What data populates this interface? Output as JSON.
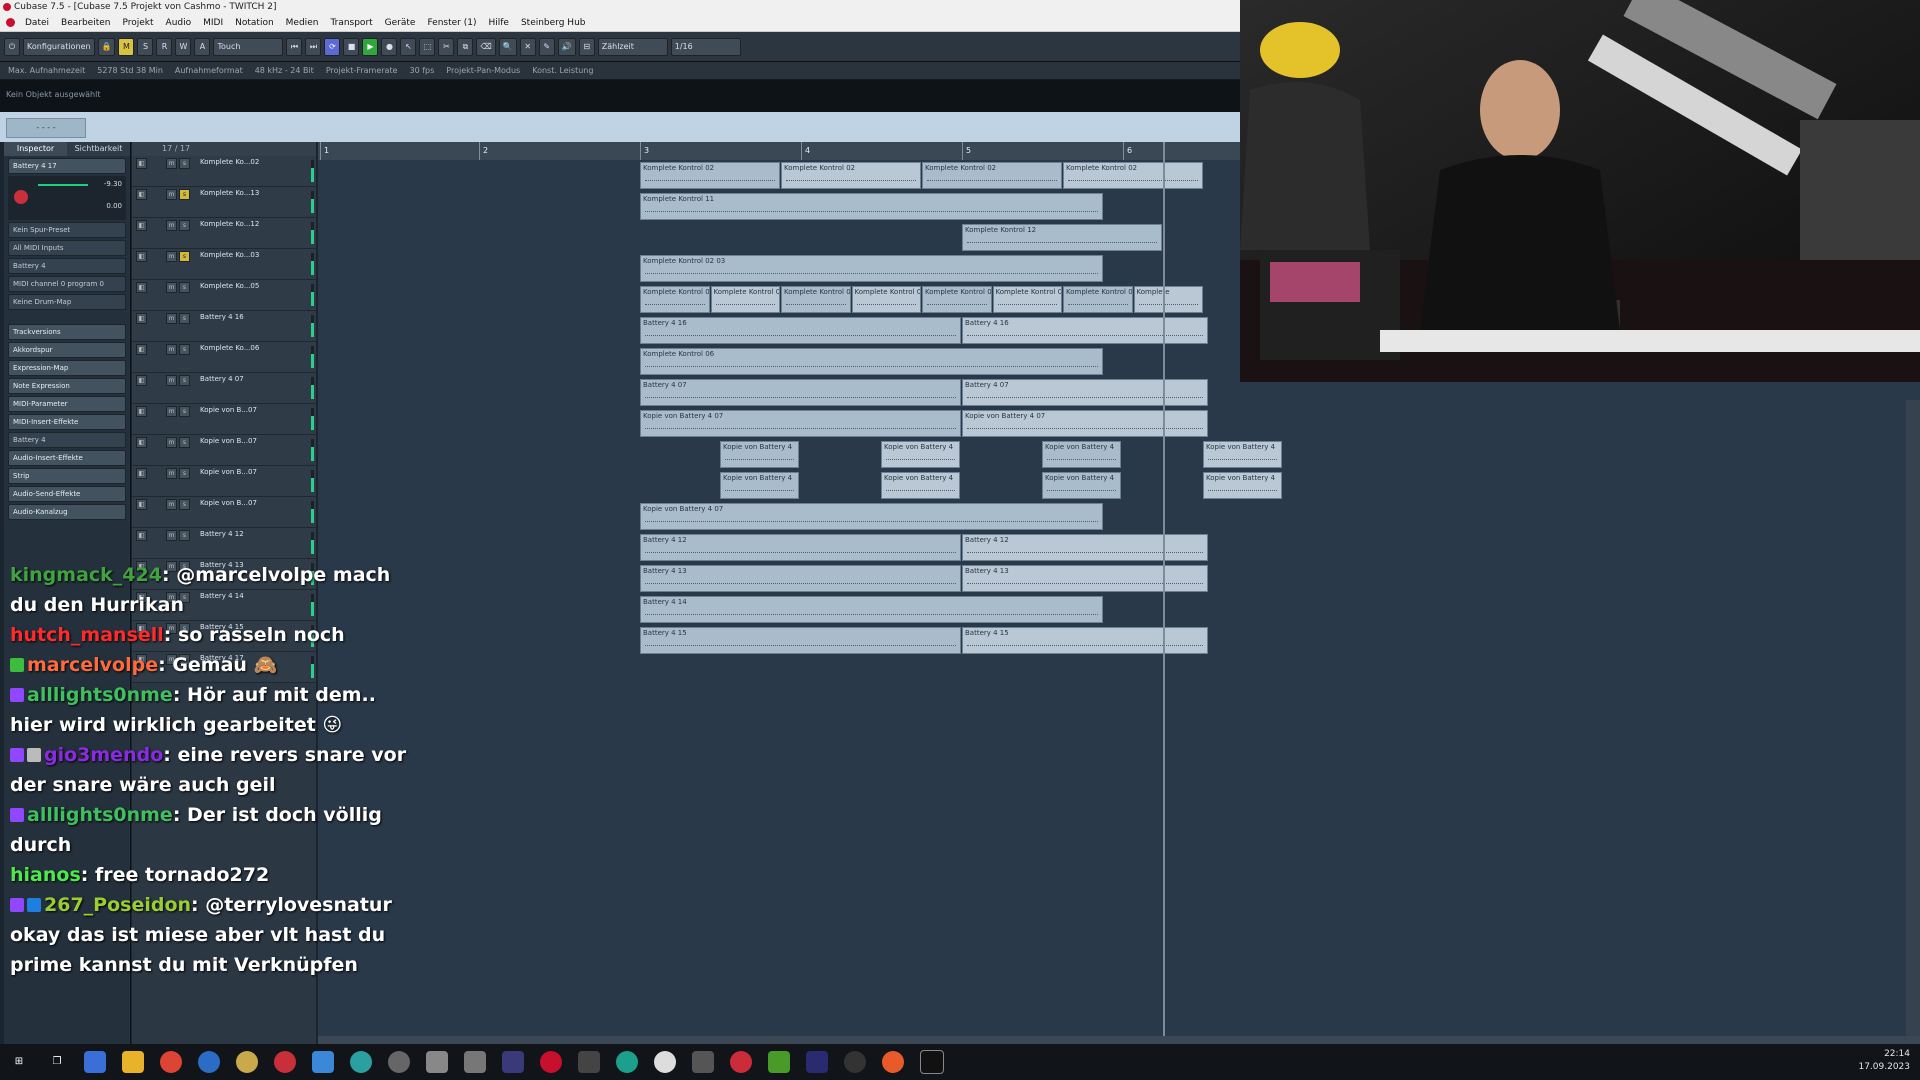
{
  "window": {
    "title": "Cubase 7.5 - [Cubase 7.5 Projekt von Cashmo - TWITCH 2]"
  },
  "menu": [
    "Datei",
    "Bearbeiten",
    "Projekt",
    "Audio",
    "MIDI",
    "Notation",
    "Medien",
    "Transport",
    "Geräte",
    "Fenster (1)",
    "Hilfe",
    "Steinberg Hub"
  ],
  "toolbar": {
    "config": "Konfigurationen",
    "automation": "Touch",
    "grid": "Zählzeit",
    "quantize": "1/16",
    "m": "M",
    "s": "S",
    "r": "R",
    "w": "W",
    "a": "A"
  },
  "info": [
    "Max. Aufnahmezeit",
    "5278 Std 38 Min",
    "Aufnahmeformat",
    "48 kHz - 24 Bit",
    "Projekt-Framerate",
    "30 fps",
    "Projekt-Pan-Modus",
    "Konst. Leistung"
  ],
  "status": "Kein Objekt ausgewählt",
  "inspector": {
    "tabs": [
      "Inspector",
      "Sichtbarkeit"
    ],
    "track_name": "Battery 4 17",
    "volume": "-9.30",
    "pan": "0.00",
    "rows": [
      "Kein Spur-Preset",
      "All MIDI Inputs",
      "Battery 4",
      "MIDI channel 0 program 0",
      "Keine Drum-Map"
    ],
    "sections": [
      "Trackversions",
      "Akkordspur",
      "Expression-Map",
      "Note Expression",
      "MIDI-Parameter",
      "MIDI-Insert-Effekte",
      "Battery 4",
      "Audio-Insert-Effekte",
      "Strip",
      "Audio-Send-Effekte",
      "Audio-Kanalzug"
    ]
  },
  "tracklist": {
    "count": "17 / 17",
    "tracks": [
      "Komplete Ko...02",
      "Komplete Ko...13",
      "Komplete Ko...12",
      "Komplete Ko...03",
      "Komplete Ko...05",
      "Battery 4 16",
      "Komplete Ko...06",
      "Battery 4 07",
      "Kopie von B...07",
      "Kopie von B...07",
      "Kopie von B...07",
      "Kopie von B...07",
      "Battery 4 12",
      "Battery 4 13",
      "Battery 4 14",
      "Battery 4 15",
      "Battery 4 17"
    ]
  },
  "ruler": [
    "1",
    "2",
    "3",
    "4",
    "5",
    "6"
  ],
  "clips": [
    [
      "Komplete Kontrol 02",
      "Komplete Kontrol 02",
      "Komplete Kontrol 02",
      "Komplete Kontrol 02"
    ],
    [
      "Komplete Kontrol 11"
    ],
    [
      "Komplete Kontrol 12"
    ],
    [
      "Komplete Kontrol 02 03"
    ],
    [
      "Komplete Kontrol 0",
      "Komplete Kontrol 0",
      "Komplete Kontrol 0",
      "Komplete Kontrol 0",
      "Komplete Kontrol 0",
      "Komplete Kontrol 0",
      "Komplete Kontrol 0",
      "Komplete"
    ],
    [
      "Battery 4 16",
      "Battery 4 16"
    ],
    [
      "Komplete Kontrol 06"
    ],
    [
      "Battery 4 07",
      "Battery 4 07"
    ],
    [
      "Kopie von Battery 4 07",
      "Kopie von Battery 4 07"
    ],
    [
      "Kopie von Battery 4",
      "Kopie von Battery 4",
      "Kopie von Battery 4",
      "Kopie von Battery 4"
    ],
    [
      "Kopie von Battery 4",
      "Kopie von Battery 4",
      "Kopie von Battery 4",
      "Kopie von Battery 4"
    ],
    [
      "Kopie von Battery 4 07"
    ],
    [
      "Battery 4 12",
      "Battery 4 12"
    ],
    [
      "Battery 4 13",
      "Battery 4 13"
    ],
    [
      "Battery 4 14"
    ],
    [
      "Battery 4 15",
      "Battery 4 15"
    ]
  ],
  "chat": [
    {
      "user": "kingmack_424",
      "color": "#3fa43f",
      "text": "@marcelvolpe mach du den Hurrikan",
      "badges": []
    },
    {
      "user": "hutch_mansell",
      "color": "#ff2a2a",
      "text": "so rasseln noch",
      "badges": []
    },
    {
      "user": "marcelvolpe",
      "color": "#ff6a3d",
      "text": "Gemau 🙈",
      "badges": [
        "#3dbd3d"
      ]
    },
    {
      "user": "alllights0nme",
      "color": "#3fbf5f",
      "text": "Hör auf mit dem.. hier wird wirklich gearbeitet 😜",
      "badges": [
        "#9147ff"
      ]
    },
    {
      "user": "gio3mendo",
      "color": "#8a2be2",
      "text": "eine revers snare vor der snare wäre auch geil",
      "badges": [
        "#9147ff",
        "#bbbbbb"
      ]
    },
    {
      "user": "alllights0nme",
      "color": "#3fbf5f",
      "text": "Der ist doch völlig durch",
      "badges": [
        "#9147ff"
      ]
    },
    {
      "user": "hianos",
      "color": "#4de84d",
      "text": "free tornado272",
      "badges": []
    },
    {
      "user": "267_Poseidon",
      "color": "#9acd32",
      "text": "@terrylovesnatur okay das ist miese aber vlt hast du prime kannst du mit Verknüpfen",
      "badges": [
        "#9147ff",
        "#1f7fe0"
      ]
    }
  ],
  "taskbar": {
    "time": "22:14",
    "date": "17.09.2023"
  }
}
